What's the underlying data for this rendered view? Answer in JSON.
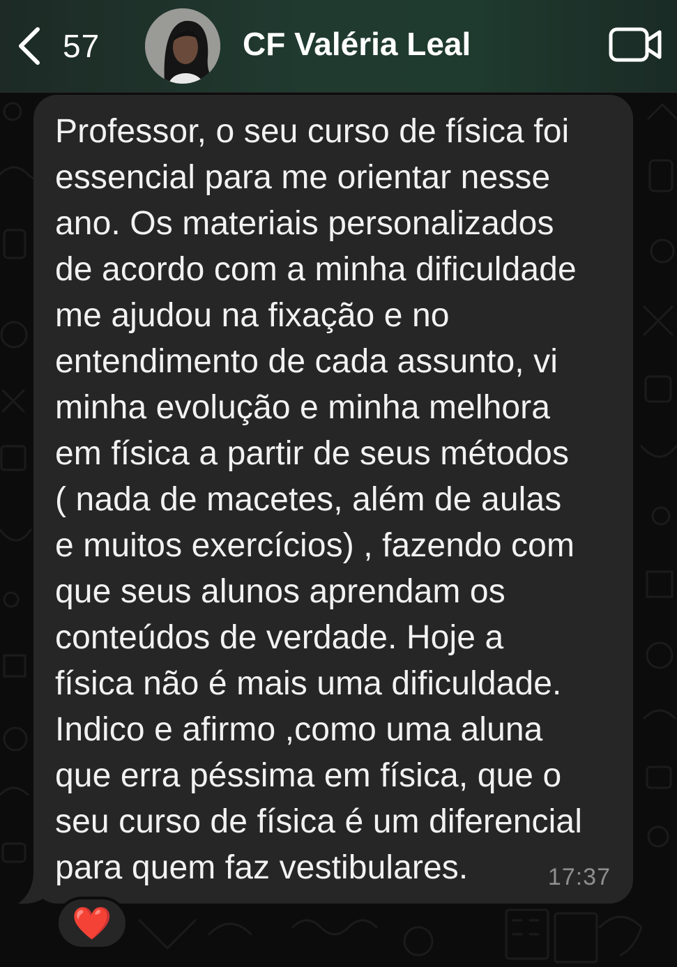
{
  "header": {
    "back_icon": "chevron-left-icon",
    "unread_count": "57",
    "contact_name": "CF Valéria Leal",
    "video_icon": "video-camera-icon"
  },
  "message": {
    "text": "Professor, o seu curso de física foi\nessencial para me orientar nesse\nano. Os materiais personalizados\nde acordo com a minha dificuldade\nme ajudou na fixação e no\nentendimento de cada assunto, vi\nminha evolução e minha melhora\nem física a partir de seus métodos\n( nada de macetes, além de aulas\ne muitos exercícios) , fazendo com\nque seus alunos aprendam os\nconteúdos de verdade. Hoje a\nfísica não é mais uma dificuldade.\nIndico e afirmo ,como uma aluna\nque erra péssima em física, que o\nseu curso de física é um diferencial\npara quem faz vestibulares.",
    "time": "17:37",
    "reaction": "❤️"
  },
  "colors": {
    "header_bg": "#1f3a2f",
    "bubble_bg": "#262626",
    "chat_bg": "#0c0c0c",
    "text": "#f2f2f2",
    "timestamp": "#8f8f8f"
  }
}
